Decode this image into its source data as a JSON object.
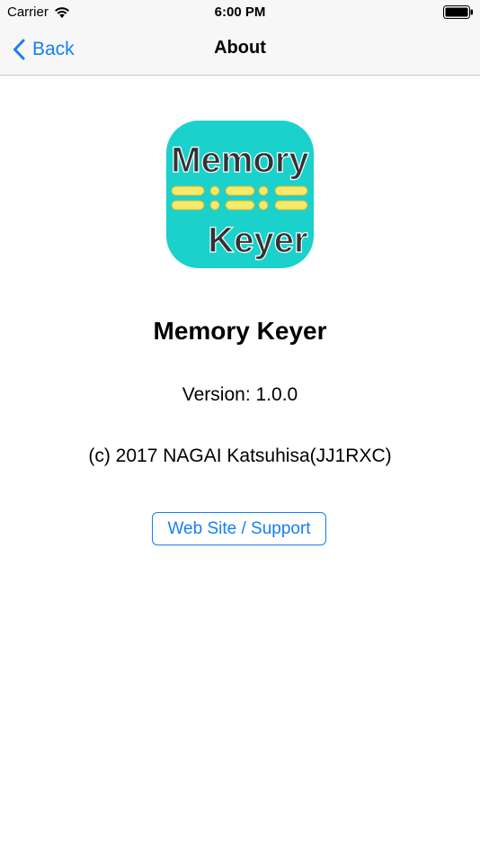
{
  "status_bar": {
    "carrier": "Carrier",
    "time": "6:00 PM",
    "wifi_icon": "wifi-icon",
    "battery_icon": "battery-icon"
  },
  "nav_bar": {
    "back_label": "Back",
    "back_icon": "chevron-left-icon",
    "title": "About"
  },
  "app": {
    "icon_text_top": "Memory",
    "icon_text_bottom": "Keyer",
    "icon_color": "#1bd1cc",
    "morse_color": "#f7e96a",
    "name": "Memory Keyer",
    "version": "Version: 1.0.0",
    "copyright": "(c) 2017 NAGAI Katsuhisa(JJ1RXC)",
    "support_button_label": "Web Site / Support"
  },
  "colors": {
    "accent": "#157efb",
    "bar_background": "#f7f7f7",
    "separator": "#c8c7cc"
  }
}
